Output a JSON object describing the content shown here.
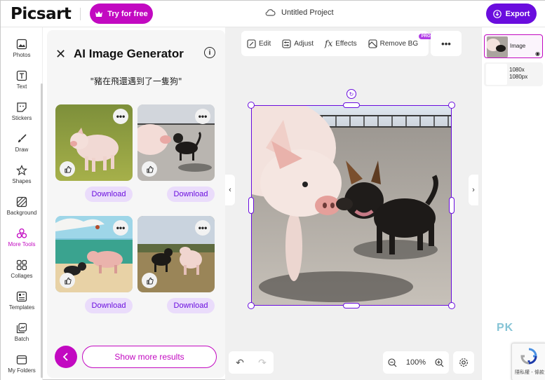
{
  "header": {
    "logo": "Picsart",
    "try_label": "Try for free",
    "project_title": "Untitled Project",
    "export_label": "Export"
  },
  "colors": {
    "brand_magenta": "#c209c1",
    "brand_purple": "#6a0dde",
    "download_bg": "#eadcfb"
  },
  "tools": [
    {
      "label": "Photos",
      "icon": "photo-icon"
    },
    {
      "label": "Text",
      "icon": "text-icon"
    },
    {
      "label": "Stickers",
      "icon": "sticker-icon"
    },
    {
      "label": "Draw",
      "icon": "brush-icon"
    },
    {
      "label": "Shapes",
      "icon": "star-icon"
    },
    {
      "label": "Background",
      "icon": "pattern-icon"
    },
    {
      "label": "More Tools",
      "icon": "more-tools-icon"
    },
    {
      "label": "Collages",
      "icon": "grid-icon"
    },
    {
      "label": "Templates",
      "icon": "template-icon"
    },
    {
      "label": "Batch",
      "icon": "batch-icon"
    },
    {
      "label": "My Folders",
      "icon": "folder-icon"
    }
  ],
  "panel": {
    "title": "AI Image Generator",
    "prompt": "\"豬在飛還遇到了一隻狗\"",
    "download_label": "Download",
    "more_results_label": "Show more results"
  },
  "edit_toolbar": {
    "edit": "Edit",
    "adjust": "Adjust",
    "effects": "Effects",
    "remove_bg": "Remove BG",
    "pro_badge": "PRO"
  },
  "zoom": {
    "value": "100%"
  },
  "layers": [
    {
      "label": "Image"
    },
    {
      "label": "1080x\n1080px"
    }
  ],
  "layers_text": {
    "image": "Image",
    "bg_line1": "1080x",
    "bg_line2": "1080px"
  },
  "watermark": "PK",
  "recaptcha_text": "隱私權 - 條款"
}
